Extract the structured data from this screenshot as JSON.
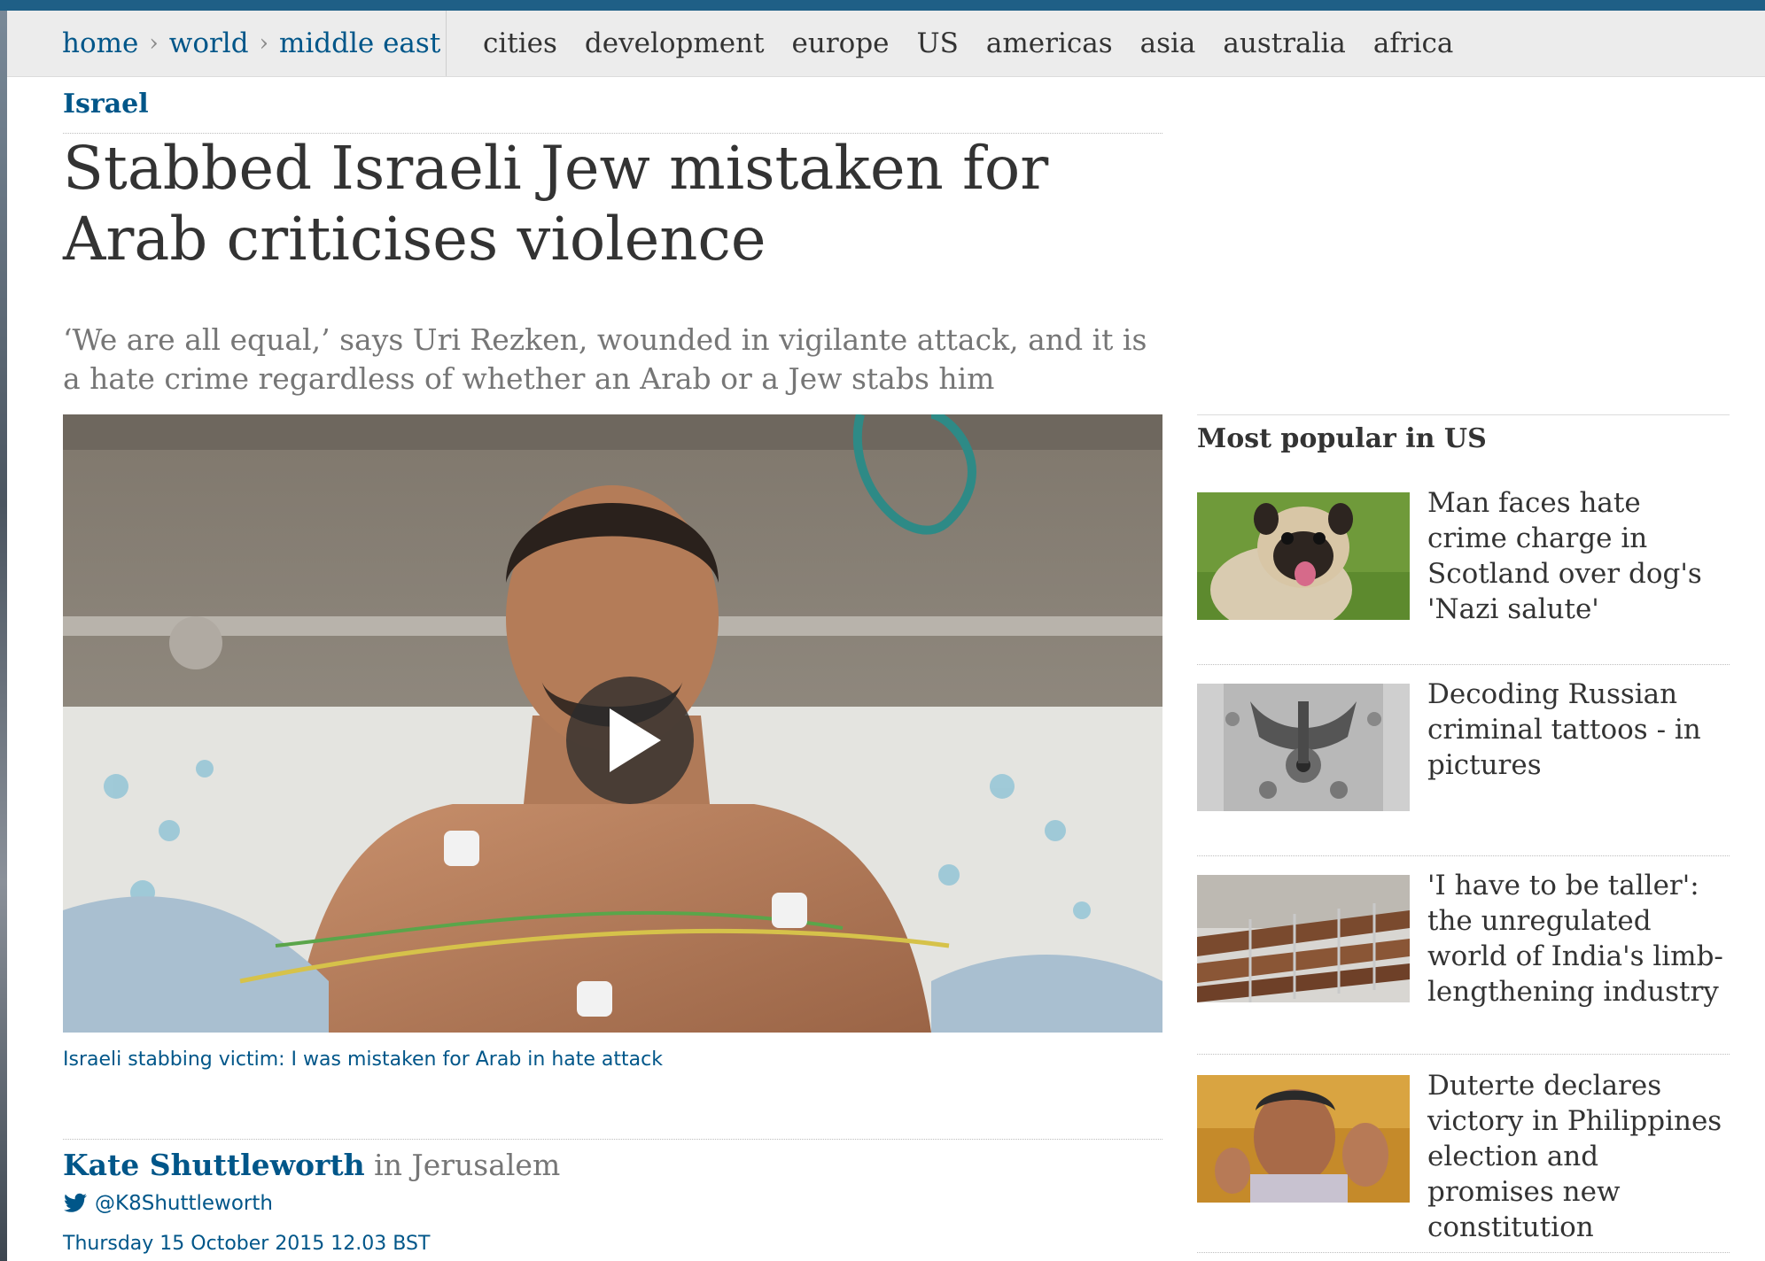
{
  "breadcrumb": [
    "home",
    "world",
    "middle east"
  ],
  "breadcrumb_separator": "›",
  "sections": [
    "cities",
    "development",
    "europe",
    "US",
    "americas",
    "asia",
    "australia",
    "africa"
  ],
  "article": {
    "kicker": "Israel",
    "headline": "Stabbed Israeli Jew mistaken for Arab criticises violence",
    "standfirst": "‘We are all equal,’ says Uri Rezken, wounded in vigilante attack, and it is a hate crime regardless of whether an Arab or a Jew stabs him",
    "video_caption": "Israeli stabbing victim: I was mistaken for Arab in hate attack",
    "author": "Kate Shuttleworth",
    "location": "in Jerusalem",
    "twitter_handle": "@K8Shuttleworth",
    "date": "Thursday 15 October 2015 12.03 BST"
  },
  "sidebar": {
    "title": "Most popular in US",
    "items": [
      {
        "title": "Man faces hate crime charge in Scotland over dog's 'Nazi salute'",
        "thumb": "pug-photo"
      },
      {
        "title": "Decoding Russian criminal tattoos - in pictures",
        "thumb": "tattoo-photo"
      },
      {
        "title": "'I have to be taller': the unregulated world of India's limb-lengthening industry",
        "thumb": "legs-photo"
      },
      {
        "title": "Duterte declares victory in Philippines election and promises new constitution",
        "thumb": "duterte-photo"
      }
    ]
  },
  "colors": {
    "link_blue": "#005689",
    "nav_bg": "#ececec",
    "text": "#333333",
    "muted": "#767676"
  }
}
